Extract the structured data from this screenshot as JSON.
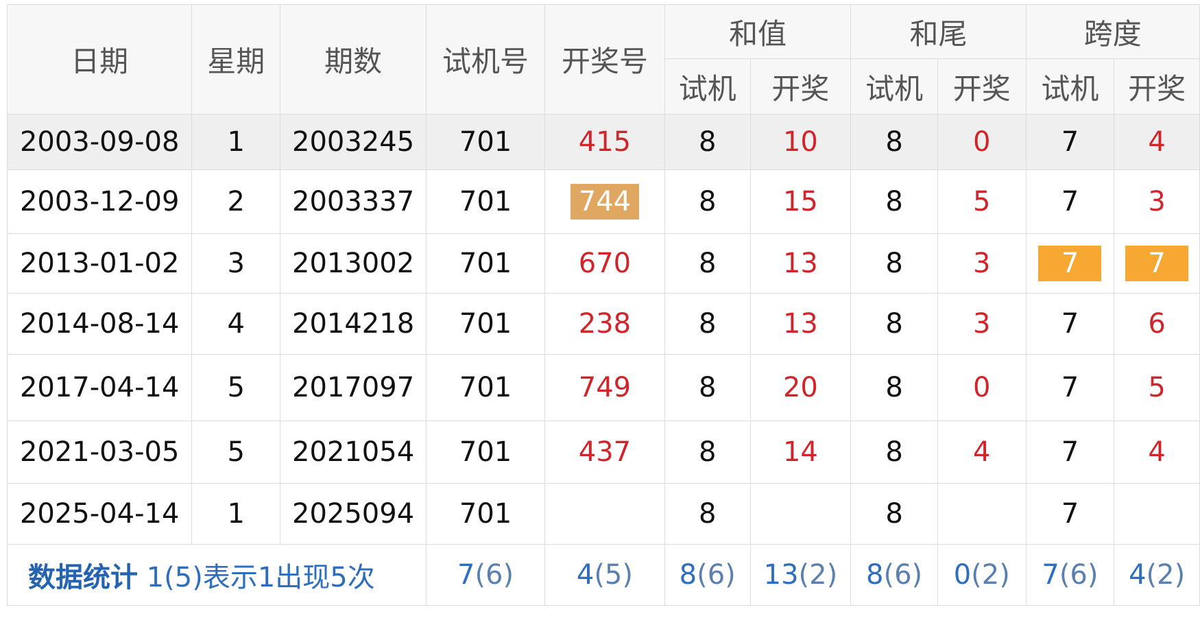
{
  "headers": {
    "date": "日期",
    "weekday": "星期",
    "issue": "期数",
    "test_number": "试机号",
    "draw_number": "开奖号",
    "sum_group": "和值",
    "tail_group": "和尾",
    "span_group": "跨度",
    "sub_test": "试机",
    "sub_draw": "开奖"
  },
  "rows": [
    {
      "date": "2003-09-08",
      "weekday": "1",
      "issue": "2003245",
      "test": "701",
      "draw": "415",
      "sum_test": "8",
      "sum_draw": "10",
      "tail_test": "8",
      "tail_draw": "0",
      "span_test": "7",
      "span_draw": "4"
    },
    {
      "date": "2003-12-09",
      "weekday": "2",
      "issue": "2003337",
      "test": "701",
      "draw": "744",
      "sum_test": "8",
      "sum_draw": "15",
      "tail_test": "8",
      "tail_draw": "5",
      "span_test": "7",
      "span_draw": "3"
    },
    {
      "date": "2013-01-02",
      "weekday": "3",
      "issue": "2013002",
      "test": "701",
      "draw": "670",
      "sum_test": "8",
      "sum_draw": "13",
      "tail_test": "8",
      "tail_draw": "3",
      "span_test": "7",
      "span_draw": "7"
    },
    {
      "date": "2014-08-14",
      "weekday": "4",
      "issue": "2014218",
      "test": "701",
      "draw": "238",
      "sum_test": "8",
      "sum_draw": "13",
      "tail_test": "8",
      "tail_draw": "3",
      "span_test": "7",
      "span_draw": "6"
    },
    {
      "date": "2017-04-14",
      "weekday": "5",
      "issue": "2017097",
      "test": "701",
      "draw": "749",
      "sum_test": "8",
      "sum_draw": "20",
      "tail_test": "8",
      "tail_draw": "0",
      "span_test": "7",
      "span_draw": "5"
    },
    {
      "date": "2021-03-05",
      "weekday": "5",
      "issue": "2021054",
      "test": "701",
      "draw": "437",
      "sum_test": "8",
      "sum_draw": "14",
      "tail_test": "8",
      "tail_draw": "4",
      "span_test": "7",
      "span_draw": "4"
    },
    {
      "date": "2025-04-14",
      "weekday": "1",
      "issue": "2025094",
      "test": "701",
      "draw": "",
      "sum_test": "8",
      "sum_draw": "",
      "tail_test": "8",
      "tail_draw": "",
      "span_test": "7",
      "span_draw": ""
    }
  ],
  "footer": {
    "title": "数据统计",
    "description": " 1(5)表示1出现5次",
    "test": {
      "value": "7",
      "count": "(6)"
    },
    "draw": {
      "value": "4",
      "count": "(5)"
    },
    "sum_test": {
      "value": "8",
      "count": "(6)"
    },
    "sum_draw": {
      "value": "13",
      "count": "(2)"
    },
    "tail_test": {
      "value": "8",
      "count": "(6)"
    },
    "tail_draw": {
      "value": "0",
      "count": "(2)"
    },
    "span_test": {
      "value": "7",
      "count": "(6)"
    },
    "span_draw": {
      "value": "4",
      "count": "(2)"
    }
  },
  "colors": {
    "red_text": "#d0252a",
    "highlight_brown": "#e0a762",
    "highlight_orange": "#f7a833",
    "stat_blue": "#2d6fbe"
  }
}
